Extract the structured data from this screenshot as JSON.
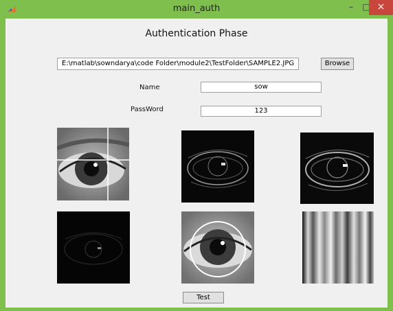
{
  "window": {
    "title": "main_auth",
    "min_label": "–",
    "max_label": "□",
    "close_label": "×"
  },
  "heading": "Authentication Phase",
  "path_value": "E:\\matlab\\sowndarya\\code Folder\\module2\\TestFolder\\SAMPLE2.JPG",
  "browse_label": "Browse",
  "name": {
    "label": "Name",
    "value": "sow"
  },
  "password": {
    "label": "PassWord",
    "value": "123"
  },
  "test_label": "Test",
  "colors": {
    "titlebar": "#7fbf4d",
    "close": "#c9463d",
    "panel": "#f0f0f0"
  },
  "icons": [
    "matlab-icon",
    "minimize-icon",
    "maximize-icon",
    "close-icon"
  ]
}
